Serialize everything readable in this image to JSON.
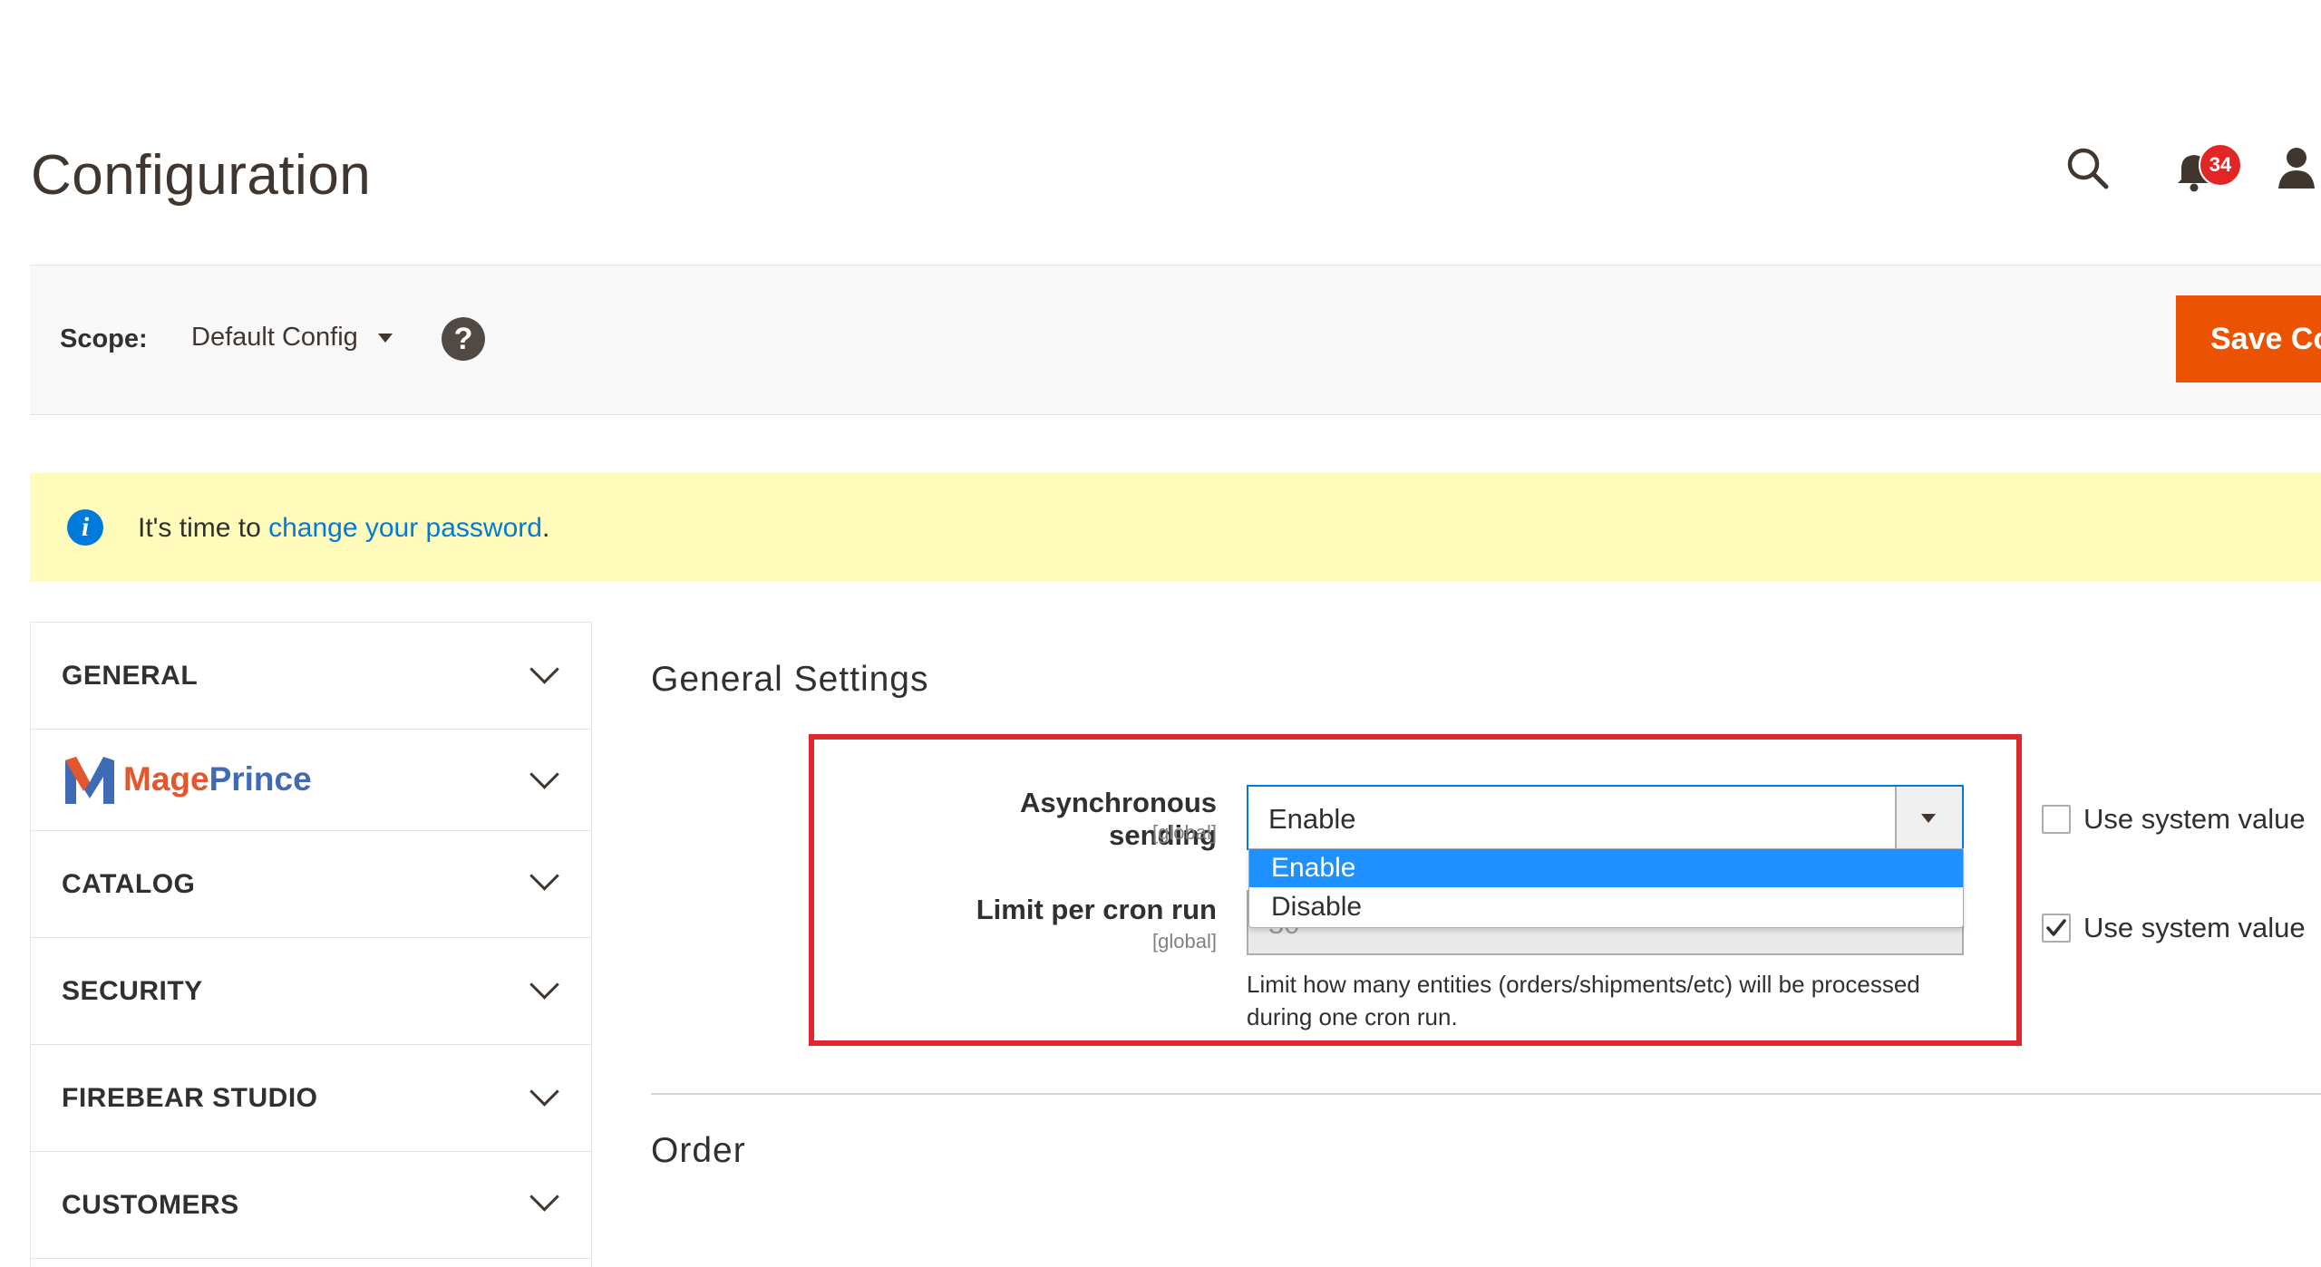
{
  "header": {
    "page_title": "Configuration",
    "notification_count": "34"
  },
  "scope": {
    "label": "Scope:",
    "value": "Default Config",
    "save_label": "Save Config",
    "help_glyph": "?"
  },
  "notice": {
    "prefix": "It's time to ",
    "link": "change your password",
    "suffix": "."
  },
  "sidebar": {
    "items": [
      {
        "label": "GENERAL"
      },
      {
        "brand_part1": "Mage",
        "brand_part2": "Prince"
      },
      {
        "label": "CATALOG"
      },
      {
        "label": "SECURITY"
      },
      {
        "label": "FIREBEAR STUDIO"
      },
      {
        "label": "CUSTOMERS"
      }
    ]
  },
  "main": {
    "section1_title": "General Settings",
    "fields": [
      {
        "label": "Asynchronous sending",
        "scope": "[global]",
        "value": "Enable",
        "options": [
          "Enable",
          "Disable"
        ],
        "use_system_value": "Use system value"
      },
      {
        "label": "Limit per cron run",
        "scope": "[global]",
        "value": "50",
        "comment": "Limit how many entities (orders/shipments/etc) will be processed during one cron run.",
        "use_system_value": "Use system value"
      }
    ],
    "section2_title": "Order"
  },
  "colors": {
    "accent": "#eb5202",
    "link": "#007bdb",
    "highlight_box": "#e0282e",
    "selected_option": "#1e90ff",
    "notice_bg": "#fffbbb"
  },
  "icons": [
    "search-icon",
    "bell-icon",
    "user-icon",
    "help-icon",
    "info-icon",
    "chevron-down-icon",
    "checkmark-icon",
    "dropdown-arrow-icon"
  ]
}
